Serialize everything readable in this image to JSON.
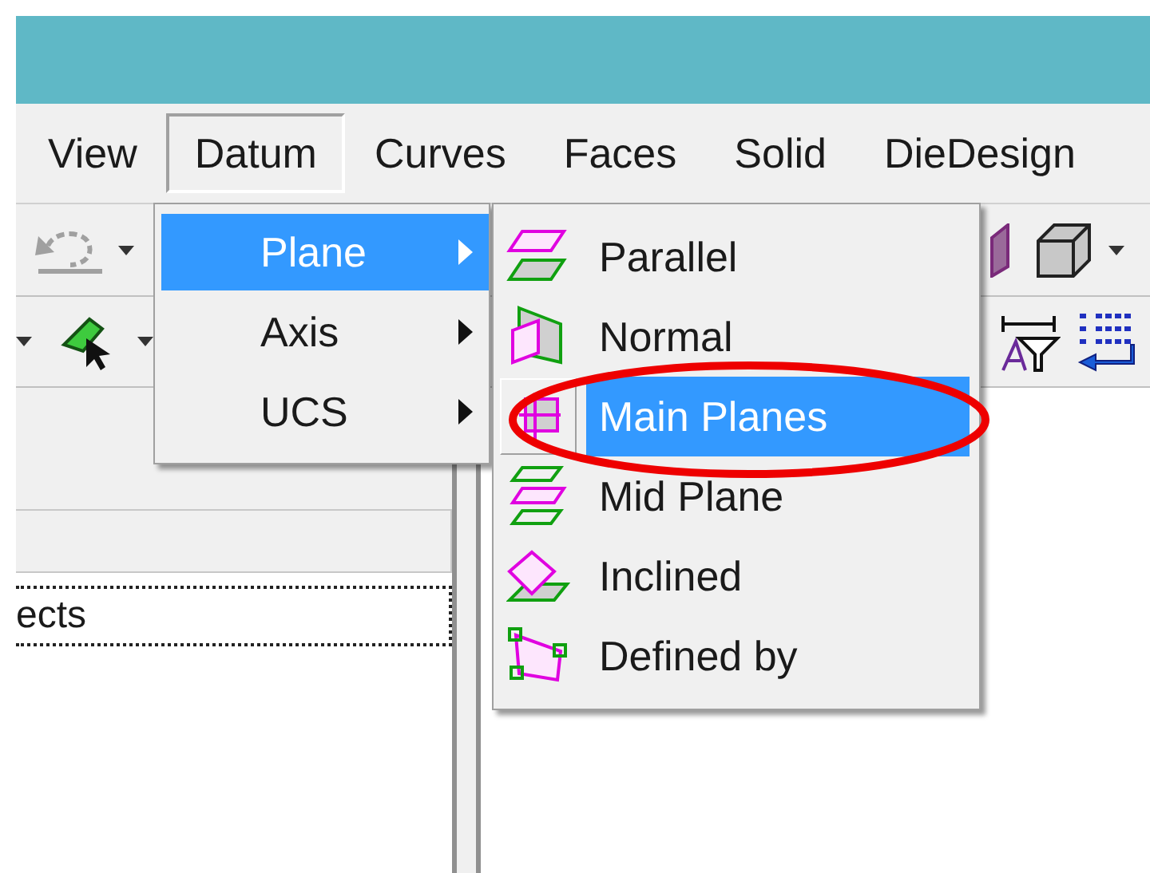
{
  "menu_bar": [
    {
      "label": "View",
      "selected": false
    },
    {
      "label": "Datum",
      "selected": true
    },
    {
      "label": "Curves",
      "selected": false
    },
    {
      "label": "Faces",
      "selected": false
    },
    {
      "label": "Solid",
      "selected": false
    },
    {
      "label": "DieDesign",
      "selected": false
    }
  ],
  "datum_menu": [
    {
      "label": "Plane",
      "selected": true
    },
    {
      "label": "Axis",
      "selected": false
    },
    {
      "label": "UCS",
      "selected": false
    }
  ],
  "plane_submenu": [
    {
      "label": "Parallel",
      "selected": false
    },
    {
      "label": "Normal",
      "selected": false
    },
    {
      "label": "Main Planes",
      "selected": true
    },
    {
      "label": "Mid Plane",
      "selected": false
    },
    {
      "label": "Inclined",
      "selected": false
    },
    {
      "label": "Defined by",
      "selected": false
    }
  ],
  "object_list": {
    "items": [
      {
        "label": "ects",
        "selected": true
      }
    ]
  }
}
